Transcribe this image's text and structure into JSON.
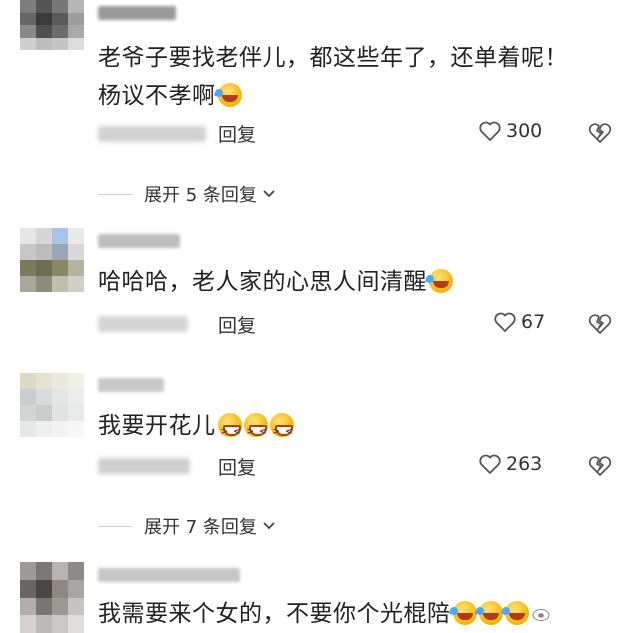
{
  "comments": [
    {
      "text_line1": "老爷子要找老伴儿，都这些年了，还单着呢！",
      "text_line2": "杨议不孝啊",
      "reply_label": "回复",
      "likes": "300",
      "expand_label": "展开 5 条回复"
    },
    {
      "text_line1": "哈哈哈，老人家的心思人间清醒",
      "reply_label": "回复",
      "likes": "67"
    },
    {
      "text_line1": "我要开花儿",
      "reply_label": "回复",
      "likes": "263",
      "expand_label": "展开 7 条回复"
    },
    {
      "text_line1": "我需要来个女的，不要你个光棍陪"
    }
  ],
  "icons": {
    "like": "heart-outline-icon",
    "dislike": "broken-heart-icon",
    "expand": "chevron-down-icon",
    "emoji_cry_laugh": "tears-of-joy-emoji",
    "emoji_laugh": "laughing-emoji"
  },
  "colors": {
    "text": "#222222",
    "icon": "#555555",
    "divider": "#cfcfcf"
  }
}
